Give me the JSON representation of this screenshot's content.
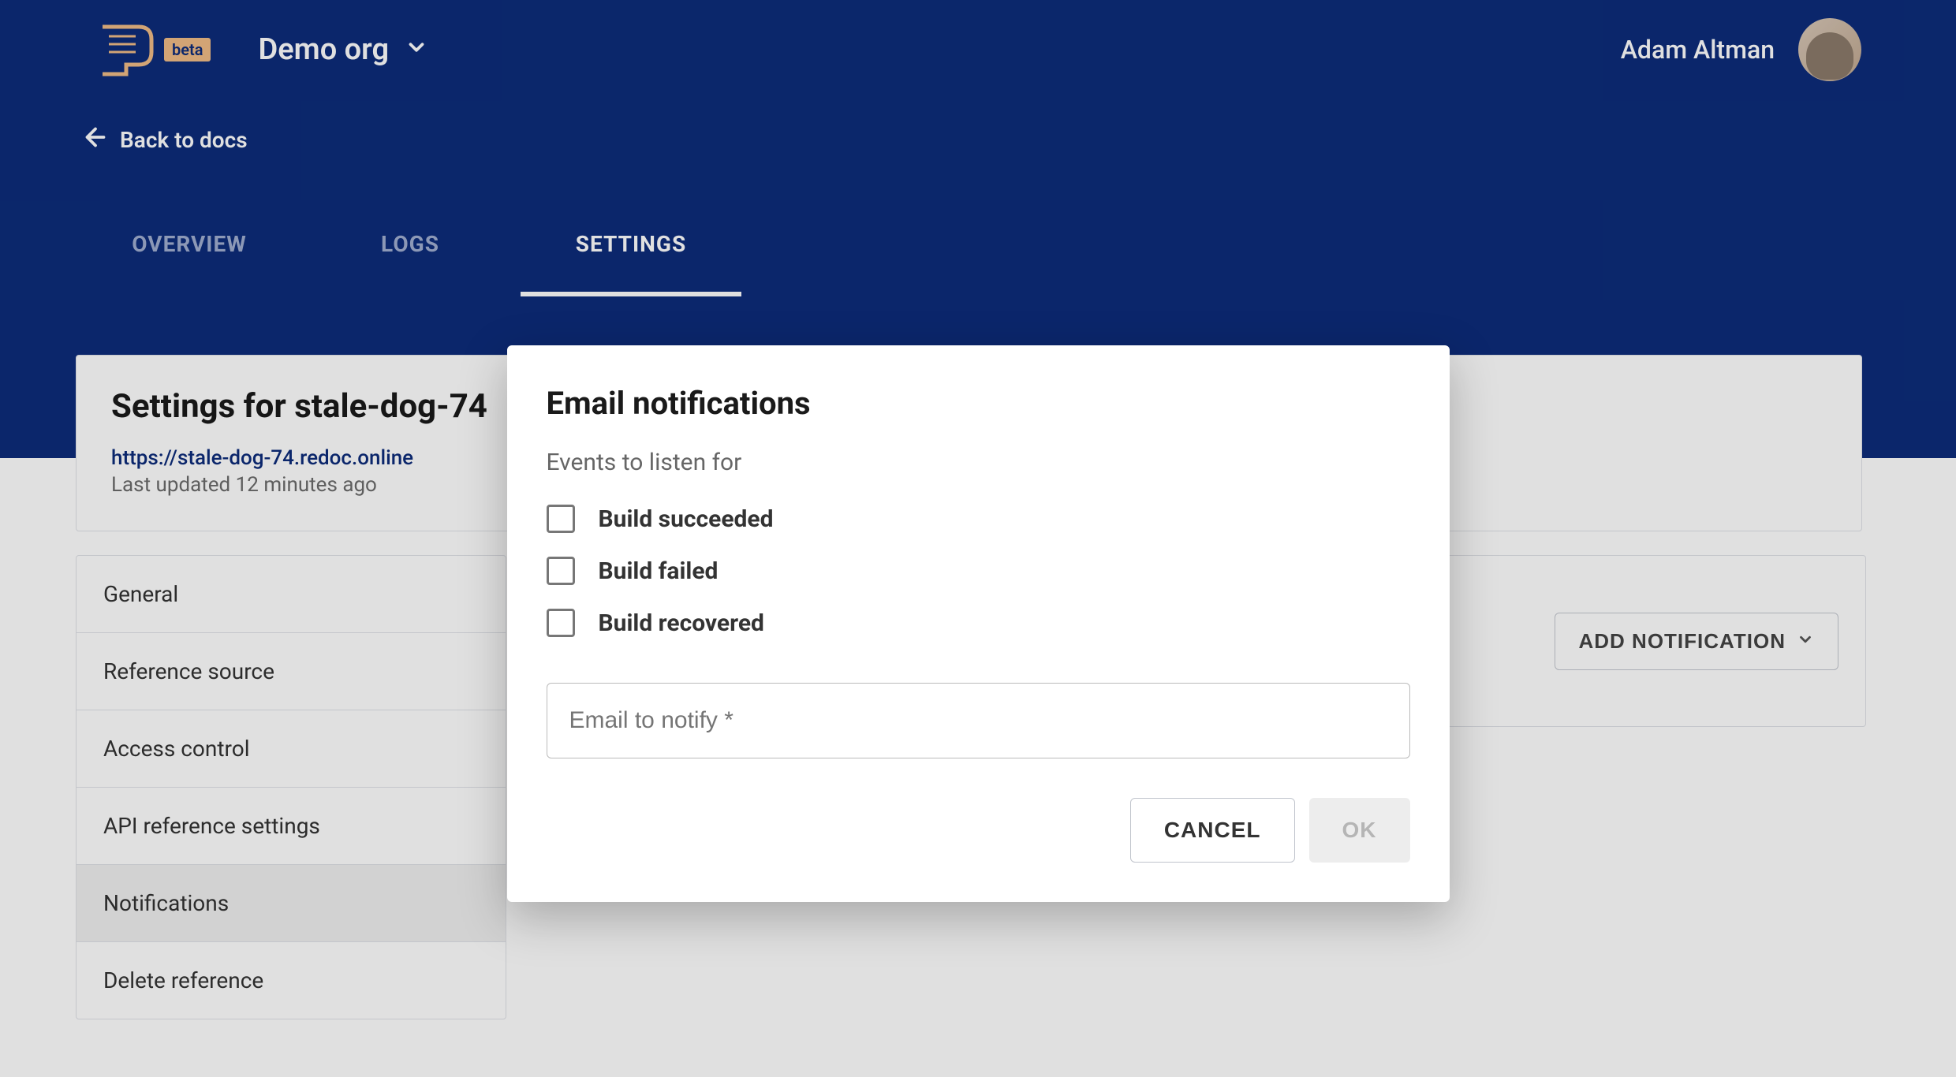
{
  "header": {
    "logo_beta": "beta",
    "org_name": "Demo org",
    "username": "Adam Altman"
  },
  "back_link": "Back to docs",
  "tabs": [
    {
      "label": "OVERVIEW",
      "active": false
    },
    {
      "label": "LOGS",
      "active": false
    },
    {
      "label": "SETTINGS",
      "active": true
    }
  ],
  "settings_card": {
    "title": "Settings for stale-dog-74",
    "url": "https://stale-dog-74.redoc.online",
    "updated": "Last updated 12 minutes ago"
  },
  "sidebar": {
    "items": [
      {
        "label": "General",
        "active": false
      },
      {
        "label": "Reference source",
        "active": false
      },
      {
        "label": "Access control",
        "active": false
      },
      {
        "label": "API reference settings",
        "active": false
      },
      {
        "label": "Notifications",
        "active": true
      },
      {
        "label": "Delete reference",
        "active": false
      }
    ]
  },
  "main": {
    "add_notification_label": "ADD NOTIFICATION"
  },
  "dialog": {
    "title": "Email notifications",
    "subtitle": "Events to listen for",
    "checkboxes": [
      {
        "label": "Build succeeded"
      },
      {
        "label": "Build failed"
      },
      {
        "label": "Build recovered"
      }
    ],
    "email_placeholder": "Email to notify *",
    "cancel": "CANCEL",
    "ok": "OK"
  }
}
